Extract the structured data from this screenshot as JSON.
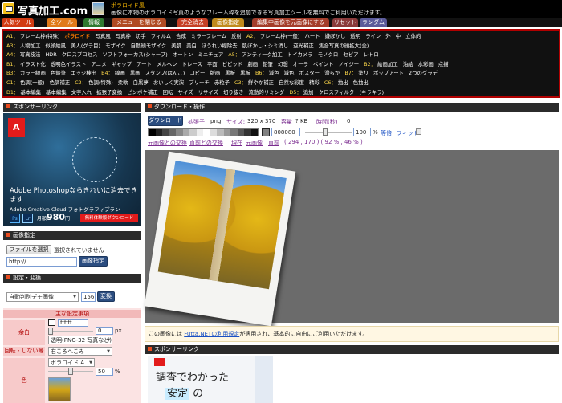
{
  "header": {
    "site_title": "写真加工.com",
    "tagline": "ポラロイド風",
    "description": "画像に本物のポラロイド写真のようなフレーム枠を追加できる写真加工ツールを無料でご利用いただけます。"
  },
  "tabs": [
    {
      "label": "人気ツール",
      "color": "#d23b12"
    },
    {
      "label": "全ツール",
      "color": "#e07a1a"
    },
    {
      "label": "情報",
      "color": "#2f7a30"
    },
    {
      "label": "メニューを閉じる",
      "color": "#b04a22"
    },
    {
      "label": "完全消去",
      "color": "#c53f25"
    },
    {
      "label": "画像指定",
      "color": "#c08a1c"
    },
    {
      "label": "編集中画像を元画像にする",
      "color": "#a43d2a"
    },
    {
      "label": "リセット",
      "color": "#8a3a3a"
    },
    {
      "label": "ランダム",
      "color": "#5a5a9a"
    }
  ],
  "categories": [
    {
      "key": "A1：",
      "items": [
        "フレーム枠(特殊)",
        "ポラロイド",
        "写真風",
        "写真枠",
        "切手",
        "フィルム",
        "合成",
        "ミラーフレーム",
        "反射"
      ],
      "key2": "A2：",
      "items2": [
        "フレーム枠(一般)",
        "ハート",
        "嫌ぼかし",
        "透明",
        "ライン",
        "外",
        "中",
        "立体的"
      ]
    },
    {
      "key": "A3：",
      "items": [
        "人物加工",
        "似顔絵風",
        "美人(グラ目)",
        "モザイク",
        "自動顔モザイク",
        "美肌",
        "美白",
        "ほうれい線除去",
        "肌ぼかし・シミ消し",
        "逆光補正",
        "集合写真の顔拡大(全)"
      ]
    },
    {
      "key": "A4：",
      "items": [
        "写真技法",
        "HDR",
        "クロスプロセス",
        "ソフトフォーカス(シャープ)",
        "オートン",
        "ミニチュア"
      ],
      "key2": "A5：",
      "items2": [
        "アンティーク加工",
        "トイカメラ",
        "モノクロ",
        "セピア",
        "レトロ"
      ]
    },
    {
      "key": "B1：",
      "items": [
        "イラスト化",
        "透明色イラスト",
        "アニメ",
        "ギャップ",
        "アート",
        "メルヘン",
        "トレース",
        "平面",
        "ビビッド",
        "劇画",
        "鉛筆",
        "幻想",
        "オーラ",
        "ペイント",
        "ノイジー"
      ],
      "key2": "B2：",
      "items2": [
        "絵画加工",
        "油絵",
        "水彩画",
        "点描"
      ]
    },
    {
      "key": "B3：",
      "items": [
        "カラー線画",
        "色鉛筆",
        "エッジ検出"
      ],
      "key2": "B4：",
      "items2": [
        "線画",
        "黒画",
        "スタンプ(はんこ)",
        "コピー",
        "版画",
        "黒板",
        "黒板"
      ],
      "key3": "B6：",
      "items3": [
        "減色",
        "減色",
        "ポスター",
        "滑らか"
      ],
      "key4": "B7：",
      "items4": [
        "塗り",
        "ポップアート",
        "2つのグラデ"
      ]
    },
    {
      "key": "C1：",
      "items": [
        "色調(一般)",
        "色調補正"
      ],
      "key2": "C2：",
      "items2": [
        "色調(特殊)",
        "柔軟",
        "白黒夢",
        "おいしく実演",
        "ブリーチ",
        "赤粒子"
      ],
      "key3": "C3：",
      "items3": [
        "鮮やか補正",
        "自然な彩度",
        "精彩"
      ],
      "key4": "C6：",
      "items4": [
        "抽出",
        "色抽出"
      ]
    },
    {
      "key": "D1：",
      "items": [
        "基本編集",
        "基本編集",
        "文字入れ",
        "拡張子変換",
        "ピンボケ補正",
        "回転",
        "サイズ",
        "リサイズ",
        "切り抜き",
        "流動的リミング"
      ],
      "key2": "D5：",
      "items2": [
        "追加",
        "クロスフィルター(キラキラ)"
      ]
    }
  ],
  "left": {
    "sponsor_label": "スポンサーリンク",
    "ad": {
      "headline": "Adobe Photoshopならきれいに消去できます",
      "sub": "Adobe Creative Cloud フォトグラフィプラン",
      "ps": "Ps",
      "lr": "Lr",
      "price_prefix": "月額",
      "price": "980",
      "price_suffix": "円",
      "trial": "無料体験版ダウンロード"
    },
    "image_spec": {
      "title": "画像指定",
      "choose_file": "ファイルを選択",
      "no_file": "選択されていません",
      "url_value": "http://",
      "submit": "画像指定"
    },
    "settings": {
      "title": "設定・変換",
      "preset": "自動判別デモ画像",
      "size_value": "156",
      "convert": "変換",
      "section_label": "主な設定事項",
      "rows": {
        "margin": {
          "label": "余白",
          "color_value": "ffffff",
          "number": "0",
          "unit": "px",
          "select": "透明(PNG-32 写真など)"
        },
        "rotation": {
          "label": "回転・しない等",
          "select": "右ころへこみ"
        },
        "color": {
          "label": "色",
          "select": "ポラロイド A",
          "percent": "50",
          "unit": "%"
        }
      }
    }
  },
  "right": {
    "download_title": "ダウンロード・操作",
    "download_btn": "ダウンロード",
    "ext_label": "拡張子",
    "ext_value": "png",
    "size_label": "サイズ:",
    "size_value": "320 x 370",
    "capacity_label": "容量",
    "capacity_value": "? KB",
    "time_label": "時間(秒)",
    "time_value": "0",
    "hex_value": "808080",
    "zoom_value": "100",
    "zoom_unit": "%",
    "same_size": "等倍",
    "fit": "フィット",
    "links": [
      "元画像との交換",
      "直前との交換",
      "現在",
      "元画像",
      "直前"
    ],
    "coords": "( 294 , 170 ) ( 92 % , 46 % )",
    "notice_pre": "この画像には ",
    "notice_link": "Futta.NETの利用規定",
    "notice_post": "が適用され、基本的に自由にご利用いただけます。",
    "sponsor_label": "スポンサーリンク",
    "ad": {
      "line1": "調査でわかった",
      "line2_mark": "安定",
      "line2_rest": "の"
    }
  }
}
